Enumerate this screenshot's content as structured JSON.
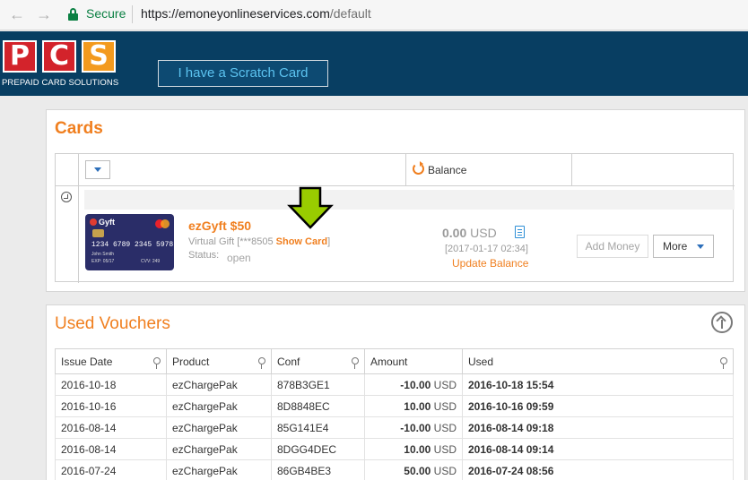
{
  "browser": {
    "secure_label": "Secure",
    "url_host": "https://emoneyonlineservices.com",
    "url_path": "/default"
  },
  "header": {
    "logo_letters": [
      "P",
      "C",
      "S"
    ],
    "logo_tagline": "PREPAID CARD SOLUTIONS",
    "scratch_button": "I have a Scratch Card"
  },
  "cards": {
    "title": "Cards",
    "balance_header": "Balance",
    "card": {
      "name": "ezGyft $50",
      "type_prefix": "Virtual Gift [***8505",
      "show_card": "Show Card",
      "type_suffix": "]",
      "status_label": "Status:",
      "status_value": "open",
      "balance_value": "0.00",
      "balance_currency": "USD",
      "balance_date": "[2017-01-17 02:34]",
      "update_balance": "Update Balance",
      "add_money": "Add Money",
      "more": "More",
      "image": {
        "brand": "Gyft",
        "number": "1234 6789 2345 5978",
        "holder": "John Smith",
        "exp": "EXP: 05/17",
        "cvv": "CVV: 249"
      }
    }
  },
  "vouchers": {
    "title": "Used Vouchers",
    "columns": [
      "Issue Date",
      "Product",
      "Conf",
      "Amount",
      "Used"
    ],
    "rows": [
      {
        "date": "2016-10-18",
        "product": "ezChargePak",
        "conf": "878B3GE1",
        "amount": "-10.00",
        "currency": "USD",
        "used": "2016-10-18 15:54"
      },
      {
        "date": "2016-10-16",
        "product": "ezChargePak",
        "conf": "8D8848EC",
        "amount": "10.00",
        "currency": "USD",
        "used": "2016-10-16 09:59"
      },
      {
        "date": "2016-08-14",
        "product": "ezChargePak",
        "conf": "85G141E4",
        "amount": "-10.00",
        "currency": "USD",
        "used": "2016-08-14 09:18"
      },
      {
        "date": "2016-08-14",
        "product": "ezChargePak",
        "conf": "8DGG4DEC",
        "amount": "10.00",
        "currency": "USD",
        "used": "2016-08-14 09:14"
      },
      {
        "date": "2016-07-24",
        "product": "ezChargePak",
        "conf": "86GB4BE3",
        "amount": "50.00",
        "currency": "USD",
        "used": "2016-07-24 08:56"
      }
    ]
  },
  "colors": {
    "accent": "#f07f1f",
    "header_bg": "#083e62",
    "arrow": "#99cc00"
  }
}
